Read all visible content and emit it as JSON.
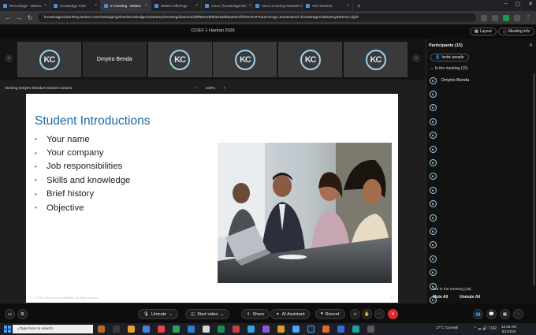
{
  "browser": {
    "tabs": [
      {
        "label": "Recordings - Webex",
        "active": false
      },
      {
        "label": "Knowledge Club",
        "active": false
      },
      {
        "label": "In meeting - Webex",
        "active": true
      },
      {
        "label": "Webex Offerings",
        "active": false
      },
      {
        "label": "Cisco | knowledgeclub",
        "active": false
      },
      {
        "label": "Cisco Learning Network Space",
        "active": false
      },
      {
        "label": "Vert Sisteme",
        "active": false
      }
    ],
    "new_tab": "+",
    "url": "knowledgeclubturkey.webex.com/webappng/sites/knowledgeclubturkey/meeting/download/8f85e3de9fa04daf9a253c0f4f4ec578?launchApp=true&siteurl=knowledgeclubturkey&theme=light",
    "window_controls": [
      "–",
      "▢",
      "✕"
    ]
  },
  "meeting": {
    "title": "CCIEF 1 Haziran 2026",
    "layout_button": "Layout",
    "info_button": "Meeting info",
    "video_tiles": [
      {
        "type": "logo",
        "text": "KC"
      },
      {
        "type": "name",
        "text": "Dmytro Benda"
      },
      {
        "type": "logo",
        "text": "KC"
      },
      {
        "type": "logo",
        "text": "KC"
      },
      {
        "type": "logo",
        "text": "KC"
      },
      {
        "type": "logo",
        "text": "KC"
      }
    ],
    "viewing_label": "Viewing Dmytro Benda's shared content",
    "zoom_minus": "–",
    "zoom_level": "100%",
    "zoom_plus": "+"
  },
  "slide": {
    "title": "Student Introductions",
    "bullets": [
      "Your name",
      "Your company",
      "Job responsibilities",
      "Skills and knowledge",
      "Brief history",
      "Objective"
    ],
    "footer": "© 2021 Cisco and/or its affiliates. All rights reserved.",
    "page": "5",
    "accent": "#1d6aa5"
  },
  "participants": {
    "title": "Participants (15)",
    "close": "✕",
    "invite_label": "Invite people",
    "in_meeting_label": "In the meeting (15)",
    "list": [
      "Dmytro Benda",
      "",
      "",
      "",
      "",
      "",
      "",
      "",
      "",
      "",
      "",
      "",
      "",
      "",
      "",
      "",
      "",
      ""
    ],
    "not_in_label": "Not in the meeting (18)",
    "mute_all": "Mute All",
    "unmute_all": "Unmute All"
  },
  "controls": {
    "unmute": "Unmute",
    "start_video": "Start video",
    "share": "Share",
    "ai_assistant": "AI Assistant",
    "record": "Record",
    "end_color": "#e02b2b"
  },
  "taskbar": {
    "search_placeholder": "Type here to search",
    "weather": "17°C  Güneşli",
    "time": "12:06 AM",
    "date": "5/1/2026",
    "tray": "^  ☁  🔊  TUR"
  }
}
